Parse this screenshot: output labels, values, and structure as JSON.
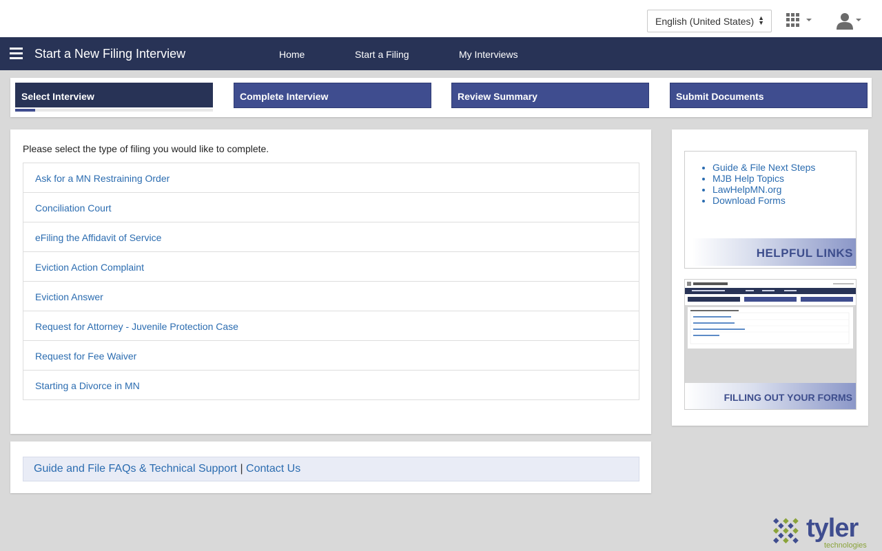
{
  "header": {
    "language_select": "English (United States)"
  },
  "navbar": {
    "title": "Start a New Filing Interview",
    "links": [
      "Home",
      "Start a Filing",
      "My Interviews"
    ]
  },
  "steps": [
    {
      "label": "Select Interview",
      "active": true
    },
    {
      "label": "Complete Interview",
      "active": false
    },
    {
      "label": "Review Summary",
      "active": false
    },
    {
      "label": "Submit Documents",
      "active": false
    }
  ],
  "main": {
    "intro": "Please select the type of filing you would like to complete.",
    "filings": [
      "Ask for a MN Restraining Order",
      "Conciliation Court",
      "eFiling the Affidavit of Service",
      "Eviction Action Complaint",
      "Eviction Answer",
      "Request for Attorney - Juvenile Protection Case",
      "Request for Fee Waiver",
      "Starting a Divorce in MN"
    ]
  },
  "footer": {
    "faq_link": "Guide and File FAQs & Technical Support",
    "separator": "|",
    "contact_link": "Contact Us"
  },
  "sidebar": {
    "helpful_links": [
      "Guide & File Next Steps",
      "MJB Help Topics",
      "LawHelpMN.org",
      "Download Forms"
    ],
    "helpful_links_title": "HELPFUL LINKS",
    "forms_title": "FILLING OUT YOUR FORMS"
  },
  "branding": {
    "logo_word": "tyler",
    "logo_sub": "technologies"
  },
  "colors": {
    "navbar": "#283356",
    "step": "#3f4d8f",
    "link": "#2b6cb0",
    "background": "#d9d9d9"
  }
}
